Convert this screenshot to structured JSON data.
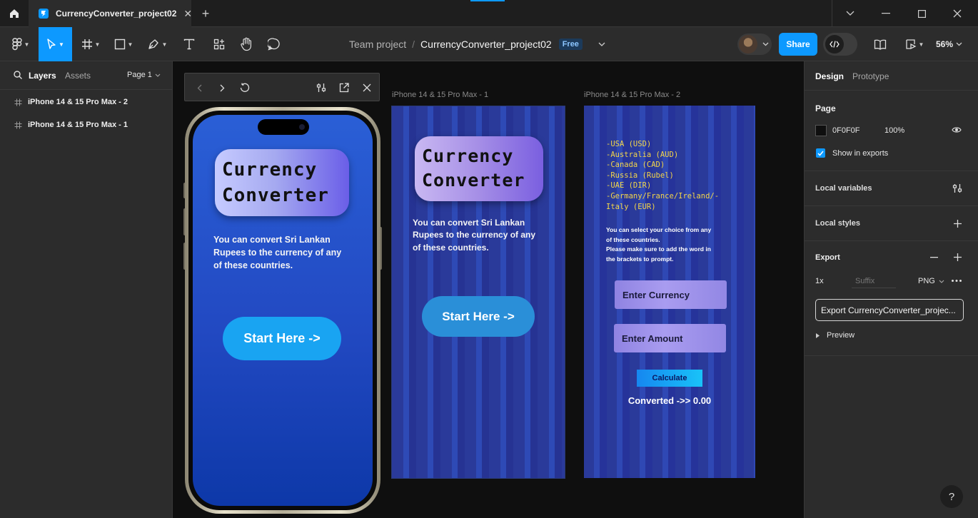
{
  "titlebar": {
    "tab_title": "CurrencyConverter_project02",
    "tab_close": "✕",
    "new_tab": "+"
  },
  "toolbar": {
    "team": "Team project",
    "separator": "/",
    "file_name": "CurrencyConverter_project02",
    "plan_badge": "Free",
    "share_label": "Share",
    "zoom": "56%",
    "active_tool": "move"
  },
  "left_panel": {
    "tabs": {
      "layers": "Layers",
      "assets": "Assets"
    },
    "page_selector": "Page 1",
    "layers": [
      {
        "label": "iPhone 14 & 15 Pro Max - 2"
      },
      {
        "label": "iPhone 14 & 15 Pro Max - 1"
      }
    ]
  },
  "canvas": {
    "phone_preview": {
      "title_line1": "Currency",
      "title_line2": "Converter",
      "description": "You can convert Sri Lankan Rupees to the currency of any of these countries.",
      "start_button": "Start Here ->"
    },
    "frame1": {
      "label": "iPhone 14 & 15 Pro Max - 1",
      "title_line1": "Currency",
      "title_line2": "Converter",
      "description": "You can convert Sri Lankan Rupees to the currency of any of these countries.",
      "start_button": "Start Here ->"
    },
    "frame2": {
      "label": "iPhone 14 & 15 Pro Max - 2",
      "countries": [
        "-USA (USD)",
        "-Australia (AUD)",
        "-Canada (CAD)",
        "-Russia (Rubel)",
        "-UAE (DIR)",
        "-Germany/France/Ireland/-",
        "Italy (EUR)"
      ],
      "note_line1": "You can select your choice from any",
      "note_line2": "of these countries.",
      "note_line3": "Please make sure to add the word in",
      "note_line4": "the brackets to prompt.",
      "currency_input": "Enter Currency",
      "amount_input": "Enter Amount",
      "calculate_button": "Calculate",
      "converted_text": "Converted ->> 0.00"
    }
  },
  "right_panel": {
    "tabs": {
      "design": "Design",
      "prototype": "Prototype"
    },
    "page": {
      "heading": "Page",
      "color_hex": "0F0F0F",
      "color_swatch": "#0f0f0f",
      "opacity": "100%",
      "show_in_exports_label": "Show in exports",
      "show_in_exports": true
    },
    "local_variables": "Local variables",
    "local_styles": "Local styles",
    "export": {
      "heading": "Export",
      "scale": "1x",
      "suffix_placeholder": "Suffix",
      "format": "PNG",
      "export_button": "Export CurrencyConverter_projec...",
      "preview_label": "Preview"
    },
    "help": "?"
  },
  "colors": {
    "accent": "#0d99ff",
    "canvas_bg": "#0f0f0f",
    "panel_bg": "#2c2c2c"
  }
}
